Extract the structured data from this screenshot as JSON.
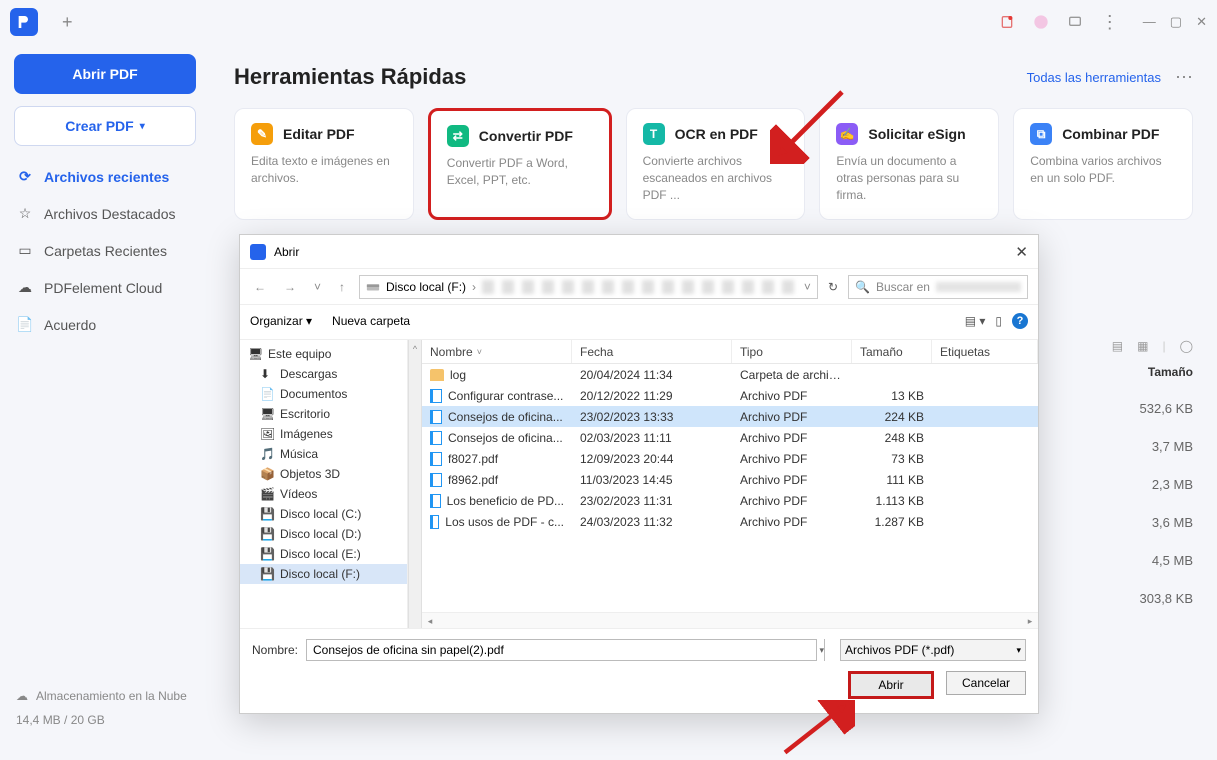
{
  "topbar": {
    "plus": "+"
  },
  "win": {
    "min": "—",
    "max": "▢",
    "close": "✕"
  },
  "sidebar": {
    "open_pdf": "Abrir PDF",
    "create_pdf": "Crear PDF",
    "items": [
      {
        "icon": "⟳",
        "label": "Archivos recientes",
        "active": true
      },
      {
        "icon": "☆",
        "label": "Archivos Destacados"
      },
      {
        "icon": "▭",
        "label": "Carpetas Recientes"
      },
      {
        "icon": "☁",
        "label": "PDFelement Cloud"
      },
      {
        "icon": "📄",
        "label": "Acuerdo"
      }
    ],
    "cloud_label": "Almacenamiento en la Nube",
    "storage": "14,4 MB / 20 GB"
  },
  "main": {
    "title": "Herramientas Rápidas",
    "all_tools": "Todas las herramientas",
    "tools": [
      {
        "color": "#f59e0b",
        "glyph": "✎",
        "title": "Editar PDF",
        "desc": "Edita texto e imágenes en archivos."
      },
      {
        "color": "#10b981",
        "glyph": "⇄",
        "title": "Convertir PDF",
        "desc": "Convertir PDF a Word, Excel, PPT, etc.",
        "hi": true
      },
      {
        "color": "#14b8a6",
        "glyph": "T",
        "title": "OCR en PDF",
        "desc": "Convierte archivos escaneados en archivos PDF ..."
      },
      {
        "color": "#8b5cf6",
        "glyph": "✍",
        "title": "Solicitar eSign",
        "desc": "Envía un documento a otras personas para su firma."
      },
      {
        "color": "#3b82f6",
        "glyph": "⧉",
        "title": "Combinar PDF",
        "desc": "Combina varios archivos en un solo PDF."
      }
    ]
  },
  "recent": {
    "header": "Tamaño",
    "sizes": [
      "532,6 KB",
      "3,7 MB",
      "2,3 MB",
      "3,6 MB",
      "4,5 MB",
      "303,8 KB"
    ]
  },
  "dialog": {
    "title": "Abrir",
    "bc_drive": "Disco local (F:)",
    "refresh": "↻",
    "search_ph": "Buscar en",
    "organize": "Organizar",
    "new_folder": "Nueva carpeta",
    "tree": [
      {
        "label": "Este equipo",
        "root": true,
        "icon": "pc"
      },
      {
        "label": "Descargas",
        "icon": "dl"
      },
      {
        "label": "Documentos",
        "icon": "doc"
      },
      {
        "label": "Escritorio",
        "icon": "desk"
      },
      {
        "label": "Imágenes",
        "icon": "img"
      },
      {
        "label": "Música",
        "icon": "mus"
      },
      {
        "label": "Objetos 3D",
        "icon": "3d"
      },
      {
        "label": "Vídeos",
        "icon": "vid"
      },
      {
        "label": "Disco local (C:)",
        "icon": "drv"
      },
      {
        "label": "Disco local (D:)",
        "icon": "drv"
      },
      {
        "label": "Disco local (E:)",
        "icon": "drv"
      },
      {
        "label": "Disco local (F:)",
        "icon": "drv",
        "sel": true
      }
    ],
    "cols": {
      "name": "Nombre",
      "date": "Fecha",
      "type": "Tipo",
      "size": "Tamaño",
      "tags": "Etiquetas"
    },
    "files": [
      {
        "name": "log",
        "date": "20/04/2024 11:34",
        "type": "Carpeta de archivos",
        "size": "",
        "folder": true
      },
      {
        "name": "Configurar contrase...",
        "date": "20/12/2022 11:29",
        "type": "Archivo PDF",
        "size": "13 KB"
      },
      {
        "name": "Consejos de oficina...",
        "date": "23/02/2023 13:33",
        "type": "Archivo PDF",
        "size": "224 KB",
        "sel": true
      },
      {
        "name": "Consejos de oficina...",
        "date": "02/03/2023 11:11",
        "type": "Archivo PDF",
        "size": "248 KB"
      },
      {
        "name": "f8027.pdf",
        "date": "12/09/2023 20:44",
        "type": "Archivo PDF",
        "size": "73 KB"
      },
      {
        "name": "f8962.pdf",
        "date": "11/03/2023 14:45",
        "type": "Archivo PDF",
        "size": "111 KB"
      },
      {
        "name": "Los beneficio de PD...",
        "date": "23/02/2023 11:31",
        "type": "Archivo PDF",
        "size": "1.113 KB"
      },
      {
        "name": "Los usos de PDF - c...",
        "date": "24/03/2023 11:32",
        "type": "Archivo PDF",
        "size": "1.287 KB"
      }
    ],
    "name_label": "Nombre:",
    "name_value": "Consejos de oficina sin papel(2).pdf",
    "filter": "Archivos PDF (*.pdf)",
    "open_btn": "Abrir",
    "cancel_btn": "Cancelar"
  }
}
